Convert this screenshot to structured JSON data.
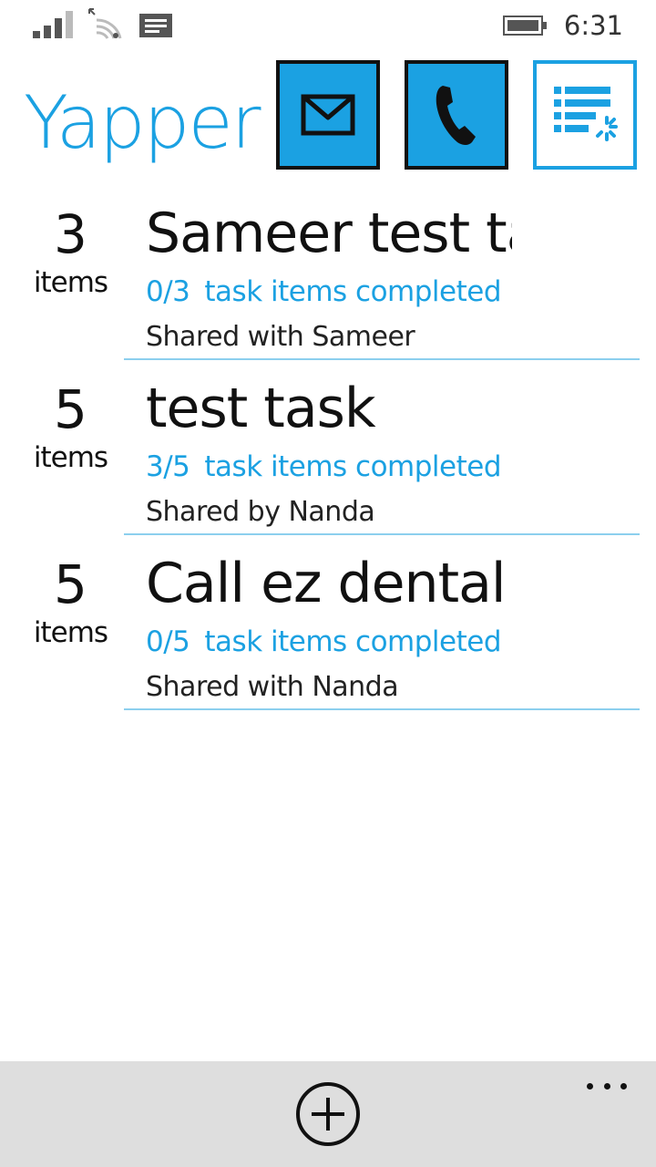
{
  "status_bar": {
    "time": "6:31",
    "icons": [
      "signal-icon",
      "wifi-icon",
      "messages-icon",
      "battery-icon"
    ],
    "signal_bars_active": 3,
    "signal_bars_total": 4
  },
  "header": {
    "app_title": "Yapper",
    "buttons": [
      {
        "name": "email-button",
        "icon": "envelope-icon"
      },
      {
        "name": "call-button",
        "icon": "phone-icon"
      },
      {
        "name": "list-refresh-button",
        "icon": "list-refresh-icon"
      }
    ]
  },
  "tasks": [
    {
      "count": "3",
      "unit": "items",
      "title": "Sameer test task",
      "progress_count": "0/3",
      "progress_label": "task items completed",
      "shared": "Shared with Sameer"
    },
    {
      "count": "5",
      "unit": "items",
      "title": "test task",
      "progress_count": "3/5",
      "progress_label": "task items completed",
      "shared": "Shared by Nanda"
    },
    {
      "count": "5",
      "unit": "items",
      "title": "Call ez dental",
      "progress_count": "0/5",
      "progress_label": "task items completed",
      "shared": "Shared with Nanda"
    }
  ],
  "app_bar": {
    "buttons": [
      {
        "name": "add-button",
        "icon": "add-circle-icon"
      },
      {
        "name": "more-button",
        "icon": "ellipsis-icon"
      }
    ]
  },
  "colors": {
    "accent": "#1ba1e2",
    "text": "#111111",
    "divider": "#8ccfee",
    "app_bar": "#dedede"
  }
}
